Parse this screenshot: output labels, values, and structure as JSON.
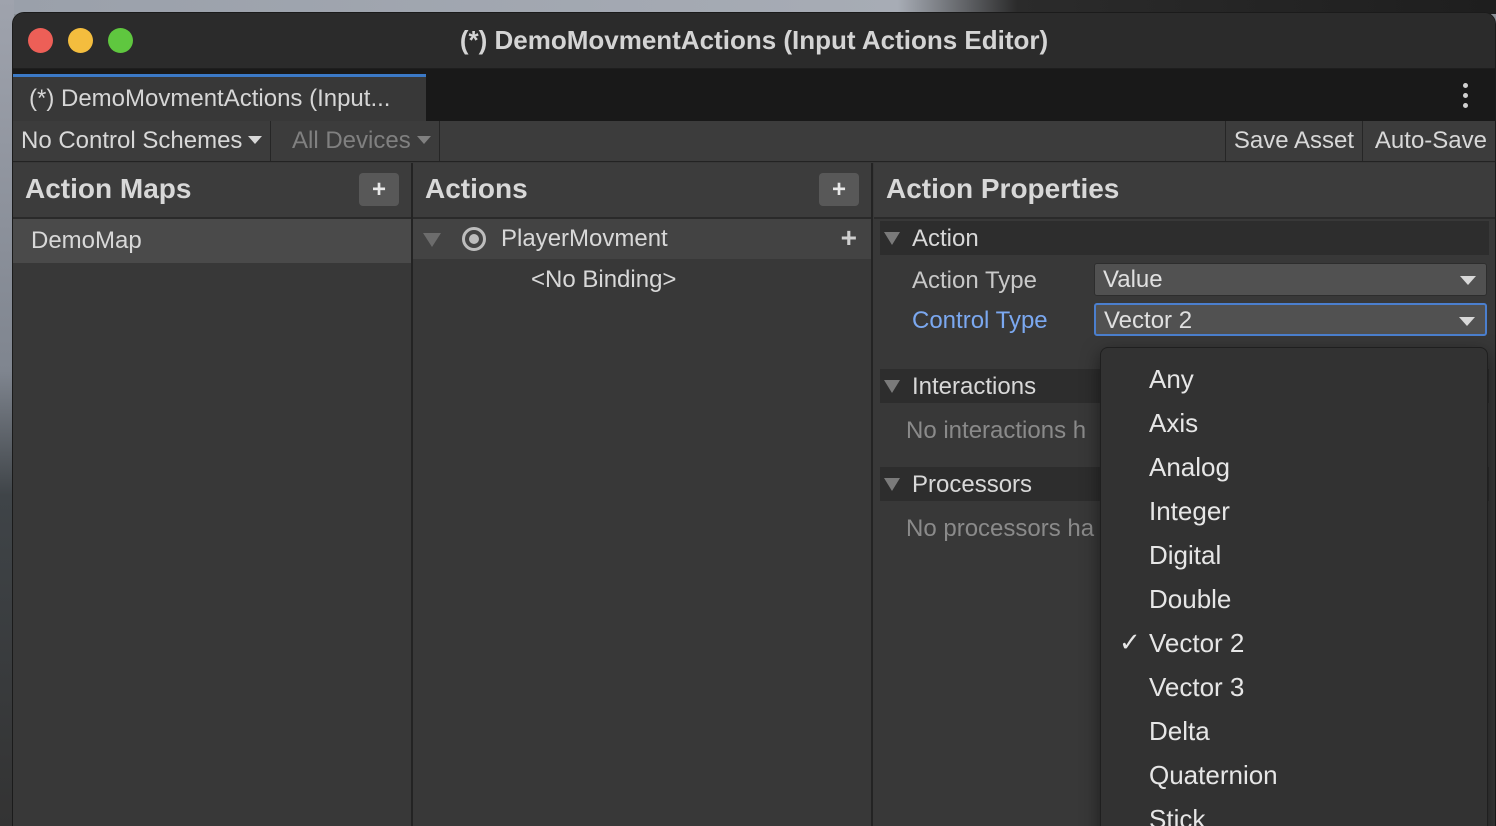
{
  "window": {
    "title": "(*) DemoMovmentActions (Input Actions Editor)"
  },
  "tab": {
    "label": "(*) DemoMovmentActions (Input..."
  },
  "toolbar": {
    "control_schemes": "No Control Schemes",
    "devices": "All Devices",
    "save_asset": "Save Asset",
    "auto_save": "Auto-Save"
  },
  "action_maps": {
    "title": "Action Maps",
    "add_label": "+",
    "items": [
      "DemoMap"
    ]
  },
  "actions": {
    "title": "Actions",
    "add_label": "+",
    "action_name": "PlayerMovment",
    "binding_label": "<No Binding>"
  },
  "properties": {
    "title": "Action Properties",
    "action_section": "Action",
    "action_type_label": "Action Type",
    "action_type_value": "Value",
    "control_type_label": "Control Type",
    "control_type_value": "Vector 2",
    "interactions_section": "Interactions",
    "interactions_empty": "No interactions h",
    "processors_section": "Processors",
    "processors_empty": "No processors ha"
  },
  "control_type_menu": {
    "selected": "Vector 2",
    "options": [
      "Any",
      "Axis",
      "Analog",
      "Integer",
      "Digital",
      "Double",
      "Vector 2",
      "Vector 3",
      "Delta",
      "Quaternion",
      "Stick"
    ]
  },
  "colors": {
    "accent": "#3b79c6",
    "label_highlight": "#7ba8f0",
    "traffic_close": "#ed5f57",
    "traffic_minimize": "#f4bd3e",
    "traffic_maximize": "#5fc73f"
  }
}
